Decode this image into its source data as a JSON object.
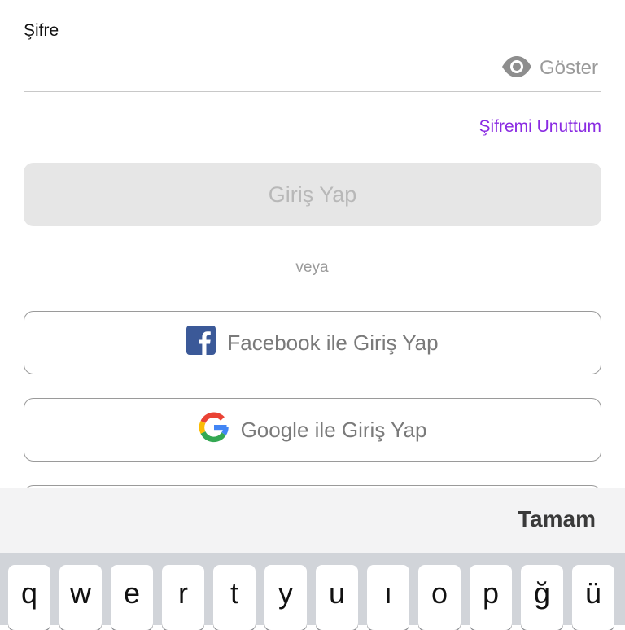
{
  "password": {
    "label": "Şifre",
    "value": "",
    "show_label": "Göster",
    "show_icon": "eye-icon"
  },
  "forgot_label": "Şifremi Unuttum",
  "login_label": "Giriş Yap",
  "divider_text": "veya",
  "social": {
    "facebook_label": "Facebook ile Giriş Yap",
    "facebook_icon": "facebook-icon",
    "google_label": "Google ile Giriş Yap",
    "google_icon": "google-icon"
  },
  "toolbar": {
    "done_label": "Tamam"
  },
  "keyboard": {
    "row1": [
      "q",
      "w",
      "e",
      "r",
      "t",
      "y",
      "u",
      "ı",
      "o",
      "p",
      "ğ",
      "ü"
    ]
  },
  "colors": {
    "accent": "#8a2be2",
    "facebook": "#3b5998",
    "disabled_bg": "#e6e6e6",
    "disabled_text": "#b8b8b8"
  }
}
